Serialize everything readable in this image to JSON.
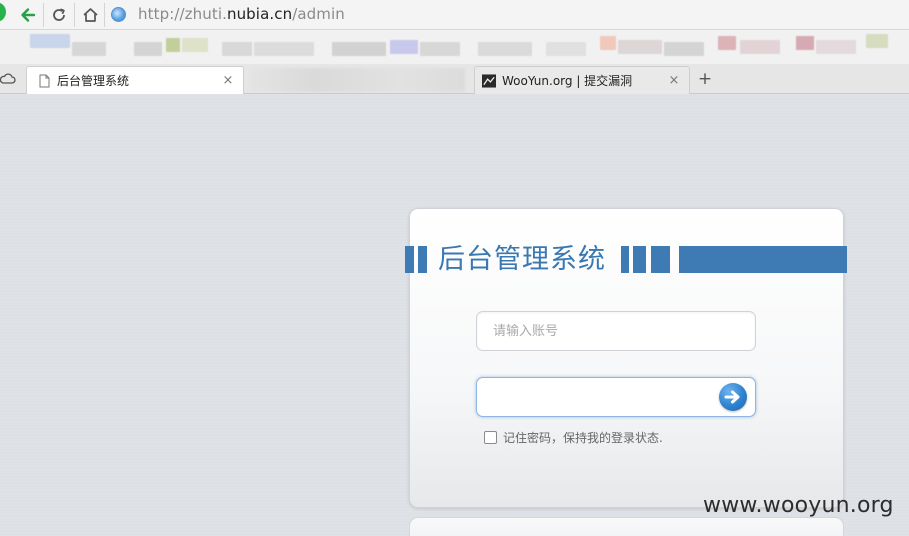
{
  "browser": {
    "url_prefix": "http://zhuti.",
    "url_host": "nubia.cn",
    "url_path": "/admin",
    "tabs": [
      {
        "title": "后台管理系统",
        "active": true,
        "icon": "page-icon"
      },
      {
        "title": "WooYun.org | 提交漏洞",
        "active": false,
        "icon": "wooyun-favicon-icon"
      }
    ],
    "new_tab_label": "+",
    "close_glyph": "×"
  },
  "login": {
    "title": "后台管理系统",
    "username_placeholder": "请输入账号",
    "password_value": "",
    "remember_label": "记住密码，保持我的登录状态.",
    "remember_checked": false,
    "accent_color": "#3e7ab3"
  },
  "watermark": "www.wooyun.org"
}
